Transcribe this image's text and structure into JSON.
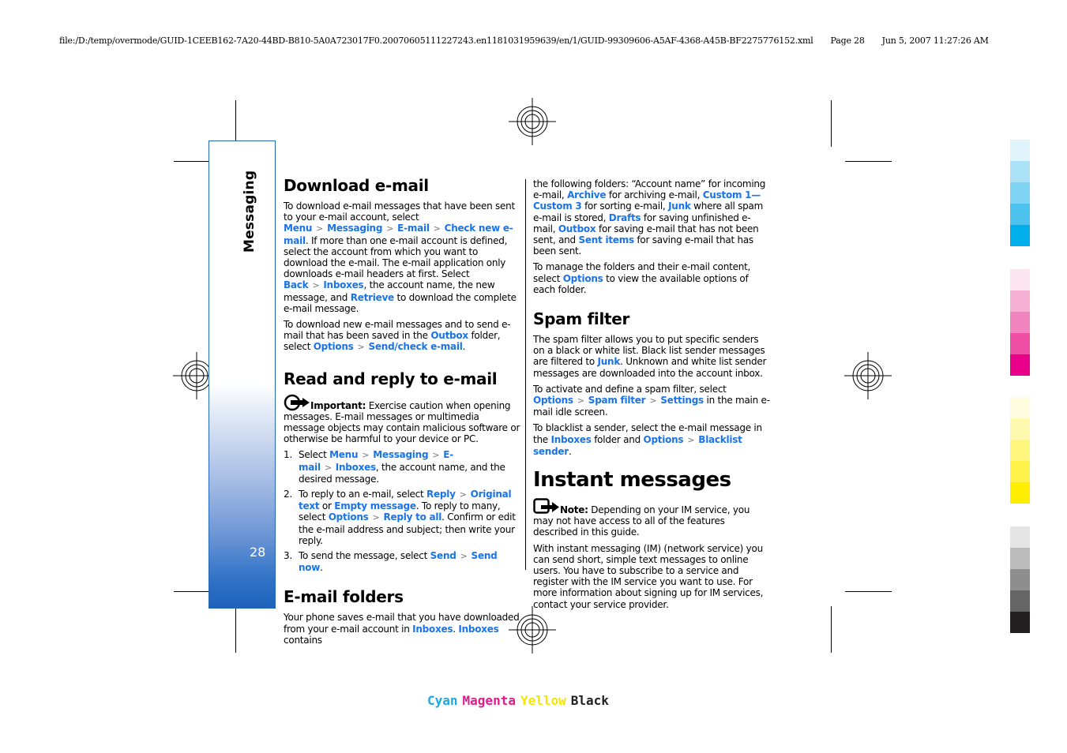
{
  "print_header": {
    "file_path": "file:/D:/temp/overmode/GUID-1CEEB162-7A20-44BD-B810-5A0A723017F0.20070605111227243.en1181031959639/en/1/GUID-99309606-A5AF-4368-A45B-BF2275776152.xml",
    "page_label": "Page 28",
    "timestamp": "Jun 5, 2007 11:27:26 AM"
  },
  "sidebar": {
    "section_title": "Messaging",
    "page_number": "28"
  },
  "separator_glyph": ">",
  "col1": {
    "download": {
      "heading": "Download e-mail",
      "p1": {
        "t1": "To download e-mail messages that have been sent to your e-mail account, select ",
        "l1": "Menu",
        "l2": "Messaging",
        "l3": "E-mail",
        "l4": "Check new e-mail",
        "t2": ". If more than one e-mail account is defined, select the account from which you want to download the e-mail. The e-mail application only downloads e-mail headers at first. Select ",
        "l5": "Back",
        "l6": "Inboxes",
        "t3": ", the account name, the new message, and ",
        "l7": "Retrieve",
        "t4": " to download the complete e-mail message."
      },
      "p2": {
        "t1": "To download new e-mail messages and to send e-mail that has been saved in the ",
        "l1": "Outbox",
        "t2": " folder, select ",
        "l2": "Options",
        "l3": "Send/check e-mail",
        "t3": "."
      }
    },
    "read_reply": {
      "heading": "Read and reply to e-mail",
      "important_label": "Important:",
      "important_text": "  Exercise caution when opening messages. E-mail messages or multimedia message objects may contain malicious software or otherwise be harmful to your device or PC.",
      "steps": [
        {
          "num": "1.",
          "t1": "Select ",
          "l1": "Menu",
          "l2": "Messaging",
          "l3": "E-mail",
          "l4": "Inboxes",
          "t2": ", the account name, and the desired message."
        },
        {
          "num": "2.",
          "t1": "To reply to an e-mail, select ",
          "l1": "Reply",
          "l2": "Original text",
          "t2": " or ",
          "l3": "Empty message",
          "t3": ". To reply to many, select ",
          "l4": "Options",
          "l5": "Reply to all",
          "t4": ". Confirm or edit the e-mail address and subject; then write your reply."
        },
        {
          "num": "3.",
          "t1": "To send the message, select ",
          "l1": "Send",
          "l2": "Send now",
          "t2": "."
        }
      ]
    },
    "folders": {
      "heading": "E-mail folders",
      "t1": "Your phone saves e-mail that you have downloaded from your e-mail account in ",
      "l1": "Inboxes",
      "t2": ". ",
      "l2": "Inboxes",
      "t3": " contains"
    }
  },
  "col2": {
    "folders_cont": {
      "p1": {
        "t1": "the following folders: “Account name” for incoming e-mail, ",
        "l1": "Archive",
        "t2": " for archiving e-mail, ",
        "l2": "Custom 1—Custom 3",
        "t3": " for sorting e-mail, ",
        "l3": "Junk",
        "t4": " where all spam e-mail is stored, ",
        "l4": "Drafts",
        "t5": " for saving unfinished e-mail, ",
        "l5": "Outbox",
        "t6": " for saving e-mail that has not been sent, and ",
        "l6": "Sent items",
        "t7": " for saving e-mail that has been sent."
      },
      "p2": {
        "t1": "To manage the folders and their e-mail content, select ",
        "l1": "Options",
        "t2": " to view the available options of each folder."
      }
    },
    "spam": {
      "heading": "Spam filter",
      "p1": {
        "t1": "The spam filter allows you to put specific senders on a black or white list. Black list sender messages are filtered to ",
        "l1": "Junk",
        "t2": ". Unknown and white list sender messages are downloaded into the account inbox."
      },
      "p2": {
        "t1": "To activate and define a spam filter, select ",
        "l1": "Options",
        "l2": "Spam filter",
        "l3": "Settings",
        "t2": " in the main e-mail idle screen."
      },
      "p3": {
        "t1": "To blacklist a sender, select the e-mail message in the ",
        "l1": "Inboxes",
        "t2": " folder and ",
        "l2": "Options",
        "l3": "Blacklist sender",
        "t3": "."
      }
    },
    "im": {
      "heading": "Instant messages",
      "note_label": "Note:",
      "note_text": "  Depending on your IM service, you may not have access to all of the features described in this guide.",
      "p1": "With instant messaging (IM) (network service) you can send short, simple text messages to online users. You have to subscribe to a service and register with the IM service you want to use. For more information about signing up for IM services, contact your service provider."
    }
  },
  "color_bar": {
    "cyan": [
      "#e0f4fc",
      "#ace2f7",
      "#7fd3f3",
      "#4cc3ef",
      "#00aeec"
    ],
    "magenta": [
      "#fce4f0",
      "#f7b1d5",
      "#f284c0",
      "#ee4ea4",
      "#e8008a"
    ],
    "yellow": [
      "#fffce0",
      "#fff9b0",
      "#fff67d",
      "#fff24a",
      "#ffee00"
    ],
    "black": [
      "#e5e5e5",
      "#bcbcbc",
      "#8e8e8e",
      "#656565",
      "#231f20"
    ]
  },
  "cmyk_labels": {
    "cyan": "Cyan",
    "magenta": "Magenta",
    "yellow": "Yellow",
    "black": "Black",
    "cyan_color": "#1ea7e4",
    "magenta_color": "#e6198a",
    "yellow_color": "#f2e700",
    "black_color": "#222222"
  },
  "link_color": "#1a73e8",
  "sidebar_accent": "#1e62bb"
}
